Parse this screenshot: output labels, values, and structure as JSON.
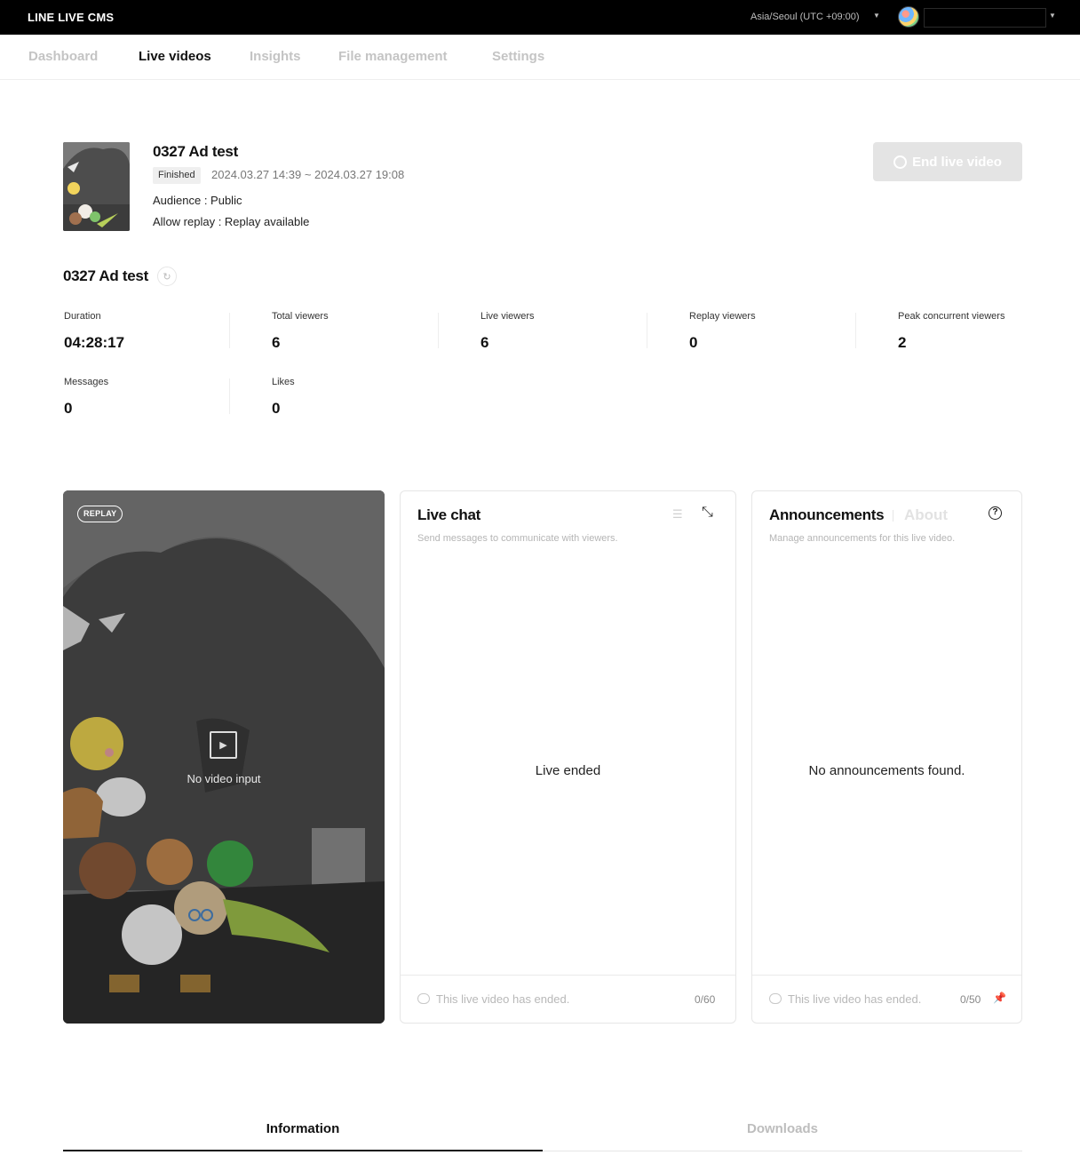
{
  "app": {
    "brand": "LINE LIVE CMS",
    "timezone": "Asia/Seoul (UTC +09:00)"
  },
  "nav": [
    {
      "label": "Dashboard",
      "active": false
    },
    {
      "label": "Live videos",
      "active": true
    },
    {
      "label": "Insights",
      "active": false
    },
    {
      "label": "File management",
      "active": false
    },
    {
      "label": "Settings",
      "active": false
    }
  ],
  "video": {
    "title": "0327 Ad test",
    "status": "Finished",
    "date_range": "2024.03.27 14:39 ~ 2024.03.27 19:08",
    "audience": "Audience : Public",
    "replay": "Allow replay : Replay available",
    "end_button": "End live video"
  },
  "stats": {
    "title": "0327 Ad test",
    "items": [
      {
        "label": "Duration",
        "value": "04:28:17"
      },
      {
        "label": "Total viewers",
        "value": "6"
      },
      {
        "label": "Live viewers",
        "value": "6"
      },
      {
        "label": "Replay viewers",
        "value": "0"
      },
      {
        "label": "Peak concurrent viewers",
        "value": "2"
      },
      {
        "label": "Messages",
        "value": "0"
      },
      {
        "label": "Likes",
        "value": "0"
      }
    ]
  },
  "player": {
    "badge": "REPLAY",
    "no_input": "No video input"
  },
  "chat": {
    "title": "Live chat",
    "subtitle": "Send messages to communicate with viewers.",
    "center": "Live ended",
    "footer": "This live video has ended.",
    "count": "0/60"
  },
  "announcements": {
    "title": "Announcements",
    "about": "About",
    "subtitle": "Manage announcements for this live video.",
    "center": "No announcements found.",
    "footer": "This live video has ended.",
    "count": "0/50"
  },
  "tabs": [
    {
      "label": "Information",
      "active": true
    },
    {
      "label": "Downloads",
      "active": false
    }
  ],
  "colors": {
    "topbar": "#000000",
    "accent": "#111111",
    "muted": "#c4c4c4"
  }
}
